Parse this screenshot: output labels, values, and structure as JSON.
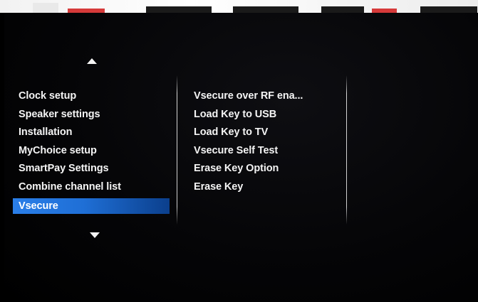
{
  "colors": {
    "background": "#000000",
    "text": "#f4f4f4",
    "selection": "#2a7ee8"
  },
  "icons": {
    "scroll_up": "triangle-up",
    "scroll_down": "triangle-down"
  },
  "main_menu": {
    "items": [
      {
        "label": "Clock setup"
      },
      {
        "label": "Speaker settings"
      },
      {
        "label": "Installation"
      },
      {
        "label": "MyChoice setup"
      },
      {
        "label": "SmartPay Settings"
      },
      {
        "label": "Combine channel list"
      },
      {
        "label": "Vsecure",
        "selected": true
      }
    ]
  },
  "sub_menu": {
    "items": [
      {
        "label": "Vsecure over RF ena..."
      },
      {
        "label": "Load Key to USB"
      },
      {
        "label": "Load Key to TV"
      },
      {
        "label": "Vsecure Self Test"
      },
      {
        "label": "Erase Key Option"
      },
      {
        "label": "Erase Key"
      }
    ]
  }
}
